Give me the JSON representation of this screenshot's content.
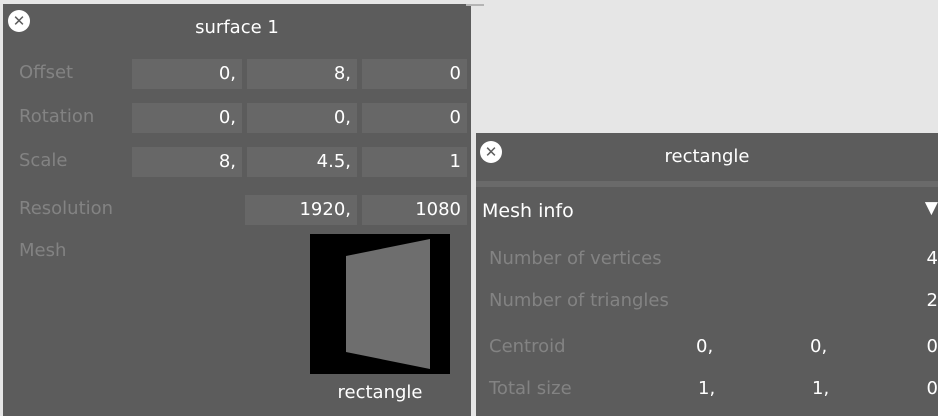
{
  "surface_panel": {
    "title": "surface 1",
    "close_icon": "close-icon",
    "offset": {
      "label": "Offset",
      "x": "0,",
      "y": "8,",
      "z": "0"
    },
    "rotation": {
      "label": "Rotation",
      "x": "0,",
      "y": "0,",
      "z": "0"
    },
    "scale": {
      "label": "Scale",
      "x": "8,",
      "y": "4.5,",
      "z": "1"
    },
    "resolution": {
      "label": "Resolution",
      "w": "1920,",
      "h": "1080"
    },
    "mesh": {
      "label": "Mesh",
      "name": "rectangle"
    }
  },
  "rect_panel": {
    "title": "rectangle",
    "close_icon": "close-icon",
    "section": {
      "label": "Mesh info",
      "toggle": "▼"
    },
    "vertices": {
      "label": "Number of vertices",
      "value": "4"
    },
    "triangles": {
      "label": "Number of triangles",
      "value": "2"
    },
    "centroid": {
      "label": "Centroid",
      "x": "0,",
      "y": "0,",
      "z": "0"
    },
    "total_size": {
      "label": "Total size",
      "x": "1,",
      "y": "1,",
      "z": "0"
    }
  }
}
